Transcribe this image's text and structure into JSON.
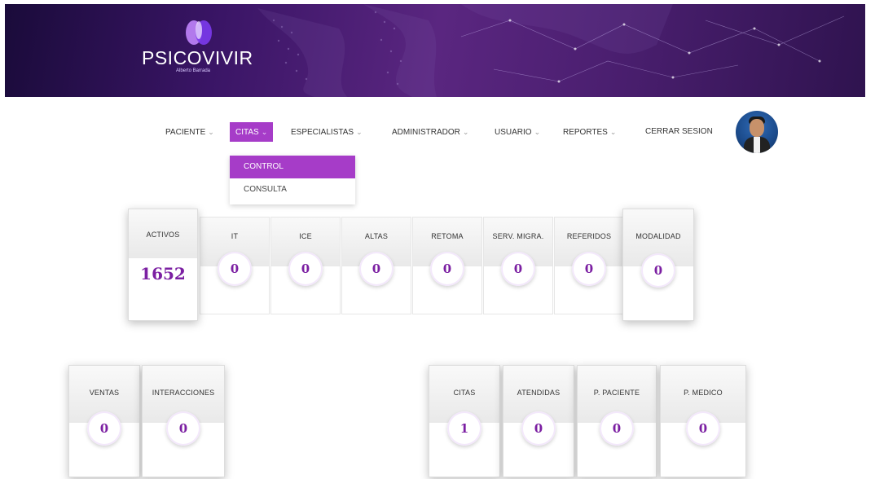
{
  "brand": {
    "name": "PSICOVIVIR",
    "tagline": "Alberto Barrada"
  },
  "nav": {
    "items": [
      {
        "label": "PACIENTE"
      },
      {
        "label": "CITAS"
      },
      {
        "label": "ESPECIALISTAS"
      },
      {
        "label": "ADMINISTRADOR"
      },
      {
        "label": "USUARIO"
      },
      {
        "label": "REPORTES"
      }
    ],
    "logout": "CERRAR SESION",
    "active_color": "#a63cc8"
  },
  "dropdown": {
    "items": [
      {
        "label": "CONTROL",
        "active": true
      },
      {
        "label": "CONSULTA",
        "active": false
      }
    ]
  },
  "stats_top": [
    {
      "label": "ACTIVOS",
      "value": "1652"
    },
    {
      "label": "IT",
      "value": "0"
    },
    {
      "label": "ICE",
      "value": "0"
    },
    {
      "label": "ALTAS",
      "value": "0"
    },
    {
      "label": "RETOMA",
      "value": "0"
    },
    {
      "label": "SERV. MIGRA.",
      "value": "0"
    },
    {
      "label": "REFERIDOS",
      "value": "0"
    },
    {
      "label": "MODALIDAD",
      "value": "0"
    }
  ],
  "stats_left": [
    {
      "label": "VENTAS",
      "value": "0"
    },
    {
      "label": "INTERACCIONES",
      "value": "0"
    }
  ],
  "stats_right": [
    {
      "label": "CITAS",
      "value": "1"
    },
    {
      "label": "ATENDIDAS",
      "value": "0"
    },
    {
      "label": "P. PACIENTE",
      "value": "0"
    },
    {
      "label": "P. MEDICO",
      "value": "0"
    }
  ]
}
